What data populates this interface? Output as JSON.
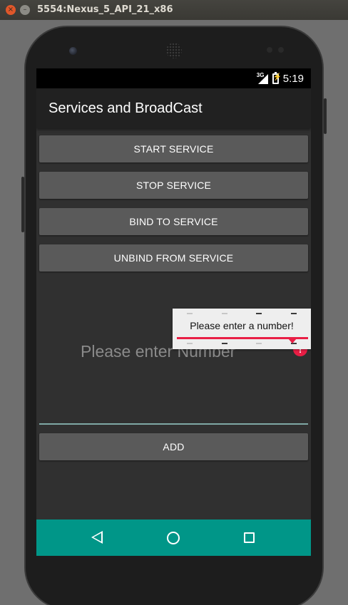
{
  "window": {
    "title": "5554:Nexus_5_API_21_x86",
    "close_icon": "×",
    "minimize_icon": "–"
  },
  "status_bar": {
    "network": "3G",
    "time": "5:19"
  },
  "app_bar": {
    "title": "Services and BroadCast"
  },
  "buttons": {
    "start": "START SERVICE",
    "stop": "STOP SERVICE",
    "bind": "BIND TO SERVICE",
    "unbind": "UNBIND FROM SERVICE",
    "add": "ADD"
  },
  "number_input": {
    "placeholder": "Please enter Number",
    "value": ""
  },
  "error": {
    "message": "Please enter a number!",
    "icon": "!"
  },
  "colors": {
    "navbar": "#009688",
    "error": "#e91e45",
    "button": "#5a5a5a",
    "app_bar": "#212121"
  },
  "nav_icons": [
    "back-icon",
    "home-icon",
    "recents-icon"
  ]
}
